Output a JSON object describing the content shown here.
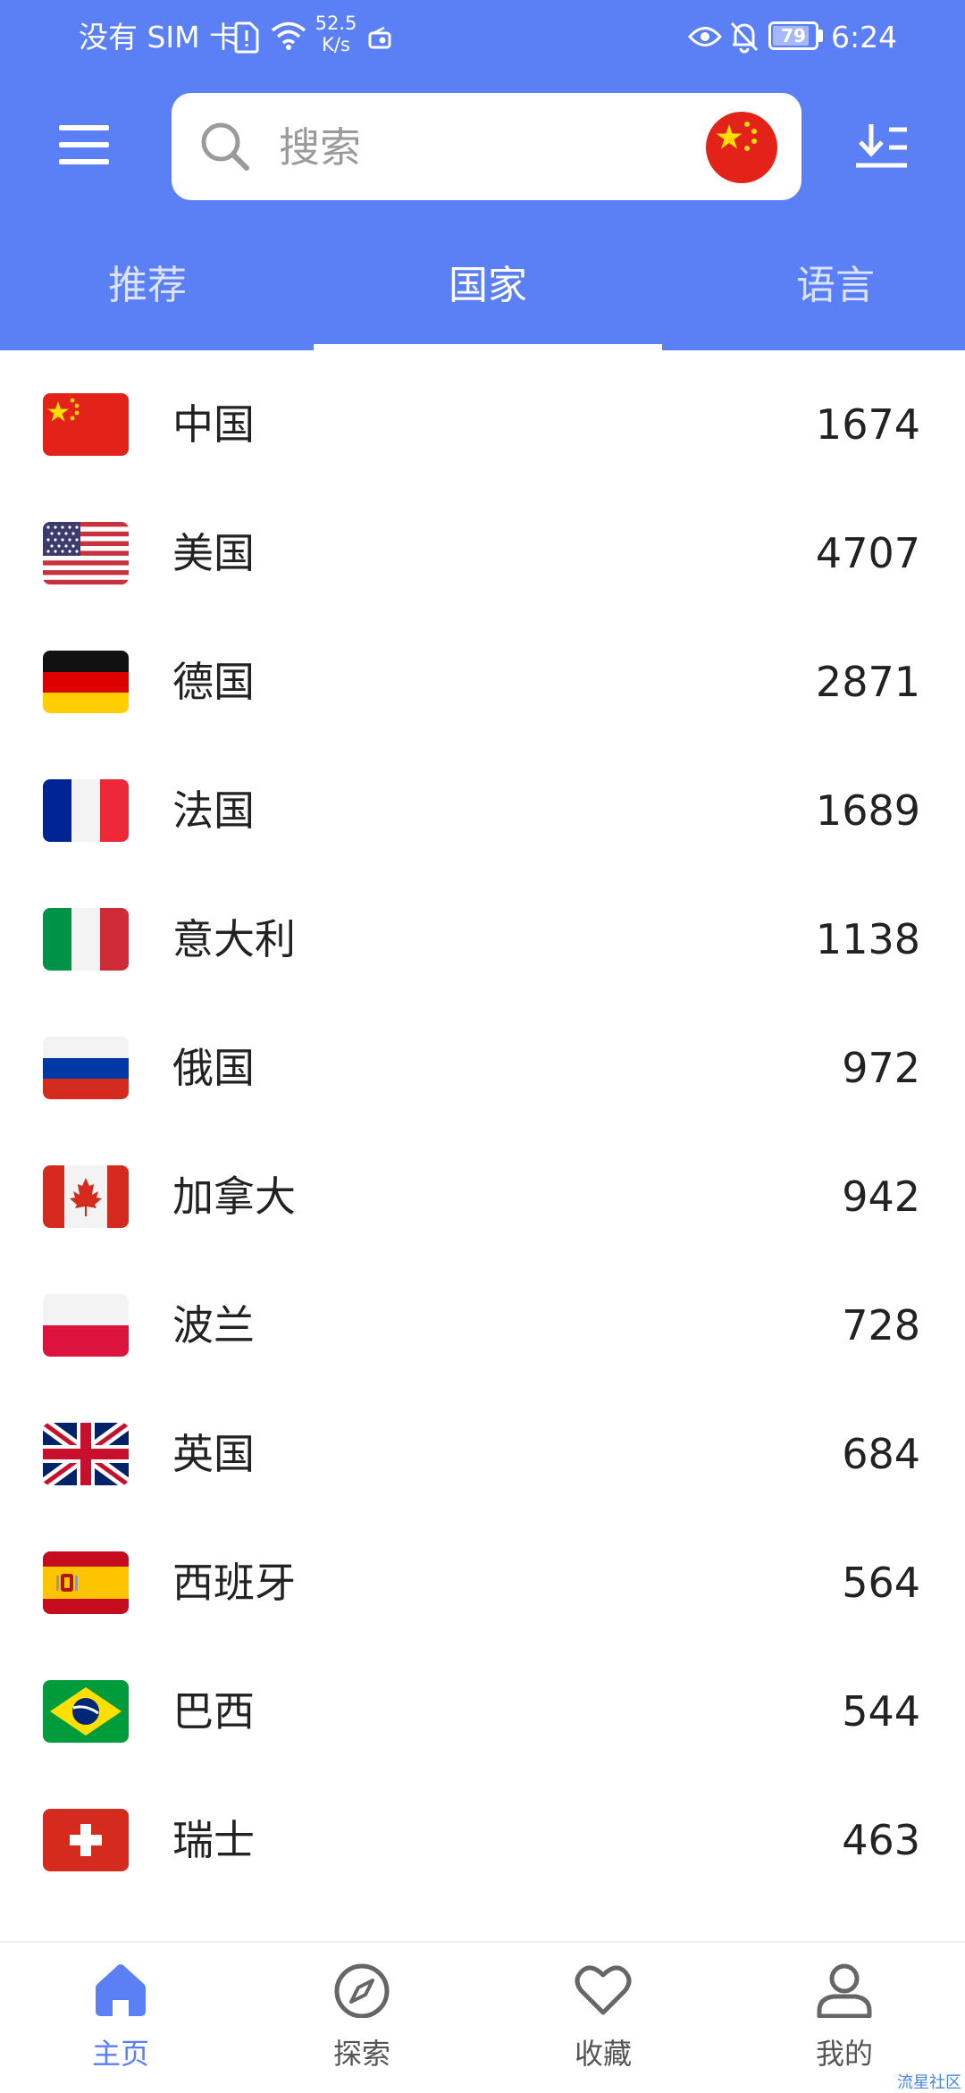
{
  "status_bar": {
    "carrier": "没有 SIM 卡",
    "net_speed_value": "52.5",
    "net_speed_unit": "K/s",
    "battery": "79",
    "time": "6:24"
  },
  "search": {
    "placeholder": "搜索"
  },
  "tabs": [
    {
      "label": "推荐",
      "active": false
    },
    {
      "label": "国家",
      "active": true
    },
    {
      "label": "语言",
      "active": false
    }
  ],
  "countries": [
    {
      "name": "中国",
      "count": "1674",
      "flag": "china-flag"
    },
    {
      "name": "美国",
      "count": "4707",
      "flag": "usa-flag"
    },
    {
      "name": "德国",
      "count": "2871",
      "flag": "germany-flag"
    },
    {
      "name": "法国",
      "count": "1689",
      "flag": "france-flag"
    },
    {
      "name": "意大利",
      "count": "1138",
      "flag": "italy-flag"
    },
    {
      "name": "俄国",
      "count": "972",
      "flag": "russia-flag"
    },
    {
      "name": "加拿大",
      "count": "942",
      "flag": "canada-flag"
    },
    {
      "name": "波兰",
      "count": "728",
      "flag": "poland-flag"
    },
    {
      "name": "英国",
      "count": "684",
      "flag": "uk-flag"
    },
    {
      "name": "西班牙",
      "count": "564",
      "flag": "spain-flag"
    },
    {
      "name": "巴西",
      "count": "544",
      "flag": "brazil-flag"
    },
    {
      "name": "瑞士",
      "count": "463",
      "flag": "switzerland-flag"
    }
  ],
  "bottom_nav": [
    {
      "label": "主页",
      "icon": "home-icon",
      "active": true
    },
    {
      "label": "探索",
      "icon": "compass-icon",
      "active": false
    },
    {
      "label": "收藏",
      "icon": "heart-icon",
      "active": false
    },
    {
      "label": "我的",
      "icon": "person-icon",
      "active": false
    }
  ],
  "watermark": "流星社区",
  "colors": {
    "primary": "#5b7ff5",
    "background": "#ffffff",
    "text": "#222222"
  }
}
